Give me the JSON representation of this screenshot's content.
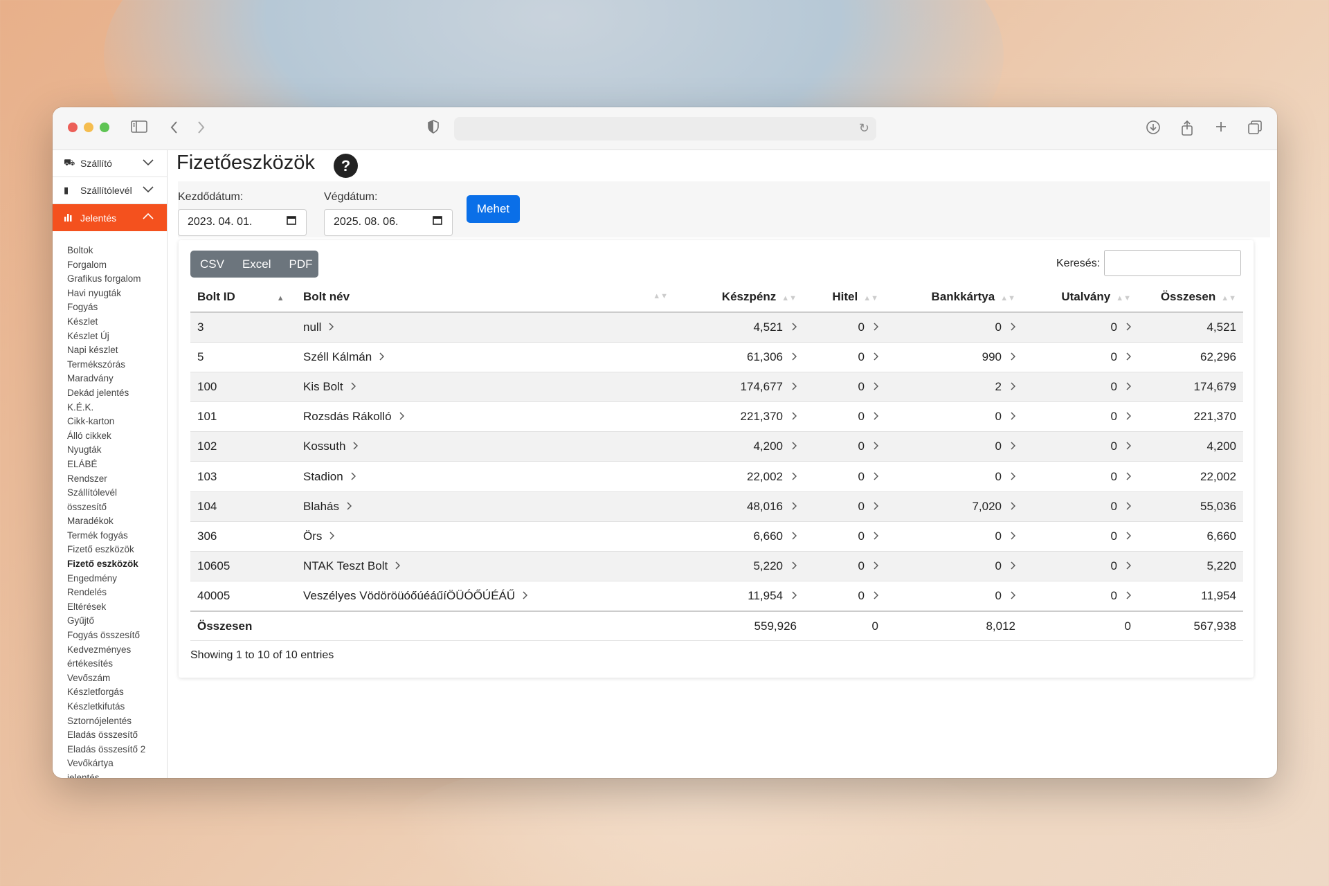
{
  "app": {
    "page_title": "Fizetőeszközök",
    "help_icon": "?"
  },
  "sidebar": {
    "menus": [
      {
        "label": "Szállító",
        "icon": "truck-icon",
        "expanded": false
      },
      {
        "label": "Szállítólevél",
        "icon": "document-icon",
        "expanded": false
      },
      {
        "label": "Jelentés",
        "icon": "bar-chart-icon",
        "expanded": true
      }
    ],
    "items": [
      "Boltok",
      "Forgalom",
      "Grafikus forgalom",
      "Havi nyugták",
      "Fogyás",
      "Készlet",
      "Készlet Új",
      "Napi készlet",
      "Termékszórás",
      "Maradvány",
      "Dekád jelentés",
      "K.É.K.",
      "Cikk-karton",
      "Álló cikkek",
      "Nyugták",
      "ELÁBÉ",
      "Rendszer",
      "Szállítólevél",
      "összesítő",
      "Maradékok",
      "Termék fogyás",
      "Fizető eszközök",
      "Fizető eszközök",
      "Engedmény",
      "Rendelés",
      "Eltérések",
      "Gyűjtő",
      "Fogyás összesítő",
      "Kedvezményes",
      "értékesítés",
      "Vevőszám",
      "Készletforgás",
      "Készletkifutás",
      "Sztornójelentés",
      "Eladás összesítő",
      "Eladás összesítő 2",
      "Vevőkártya",
      "jelentés"
    ],
    "current_index": 22
  },
  "filters": {
    "start_label": "Kezdődátum:",
    "start_value": "2023. 04. 01.",
    "end_label": "Végdátum:",
    "end_value": "2025. 08. 06.",
    "go_label": "Mehet"
  },
  "export": {
    "csv": "CSV",
    "excel": "Excel",
    "pdf": "PDF"
  },
  "search": {
    "label": "Keresés:",
    "value": ""
  },
  "table": {
    "headers": [
      "Bolt ID",
      "Bolt név",
      "Készpénz",
      "Hitel",
      "Bankkártya",
      "Utalvány",
      "Összesen"
    ],
    "rows": [
      [
        "3",
        "null",
        "4,521",
        "0",
        "0",
        "0",
        "4,521"
      ],
      [
        "5",
        "Széll Kálmán",
        "61,306",
        "0",
        "990",
        "0",
        "62,296"
      ],
      [
        "100",
        "Kis Bolt",
        "174,677",
        "0",
        "2",
        "0",
        "174,679"
      ],
      [
        "101",
        "Rozsdás Rákolló",
        "221,370",
        "0",
        "0",
        "0",
        "221,370"
      ],
      [
        "102",
        "Kossuth",
        "4,200",
        "0",
        "0",
        "0",
        "4,200"
      ],
      [
        "103",
        "Stadion",
        "22,002",
        "0",
        "0",
        "0",
        "22,002"
      ],
      [
        "104",
        "Blahás",
        "48,016",
        "0",
        "7,020",
        "0",
        "55,036"
      ],
      [
        "306",
        "Örs",
        "6,660",
        "0",
        "0",
        "0",
        "6,660"
      ],
      [
        "10605",
        "NTAK Teszt Bolt",
        "5,220",
        "0",
        "0",
        "0",
        "5,220"
      ],
      [
        "40005",
        "Veszélyes VödöröüóőúéáűíÖÜÓŐÚÉÁŰ",
        "11,954",
        "0",
        "0",
        "0",
        "11,954"
      ]
    ],
    "footer": [
      "Összesen",
      "",
      "559,926",
      "0",
      "8,012",
      "0",
      "567,938"
    ]
  },
  "info": "Showing 1 to 10 of 10 entries"
}
